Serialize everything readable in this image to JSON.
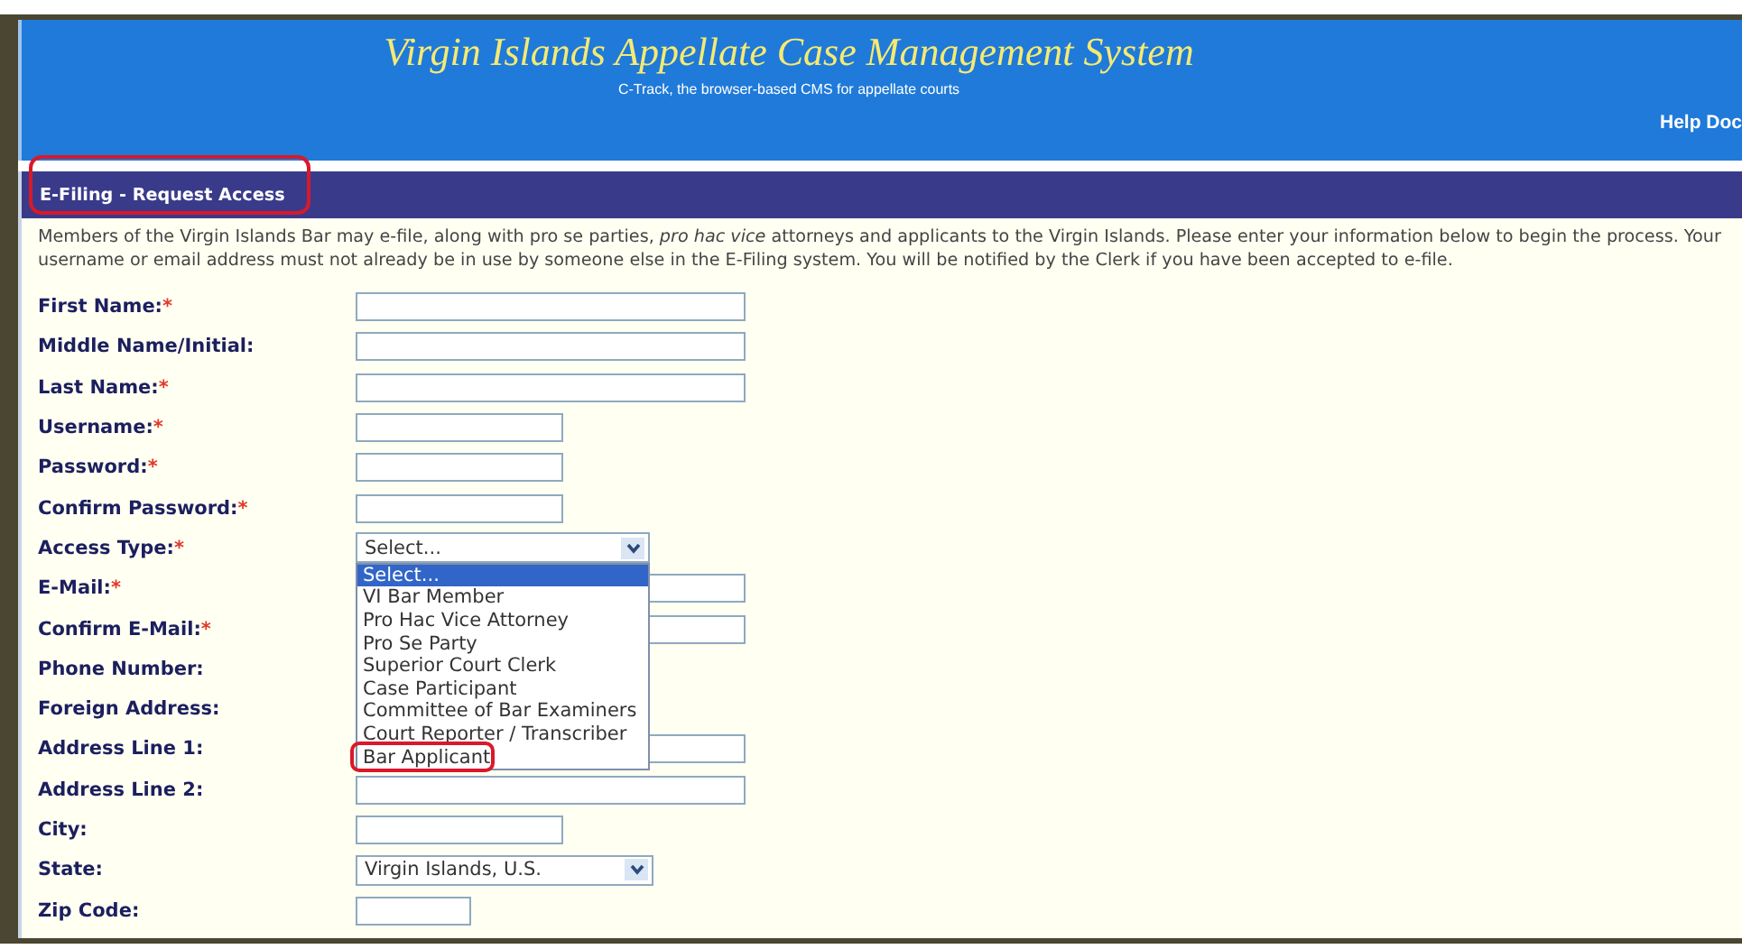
{
  "header": {
    "title": "Virgin Islands Appellate Case Management System",
    "subtitle": "C-Track, the browser-based CMS for appellate courts",
    "link": "Help Doc"
  },
  "section": {
    "title": "E-Filing - Request Access",
    "circled": true
  },
  "intro": "Members of the Virgin Islands Bar may e-file, along with pro se parties, *pro hac vice* attorneys and applicants to the Virgin Islands. Please enter your information below to begin the process. Your username or email address must not already be in use by someone else in the E-Filing system. You will be notified by the Clerk if you have been accepted to e-file.",
  "fields": [
    {
      "label": "First Name:",
      "required_mark": "*",
      "kind": "long"
    },
    {
      "label": "Middle Name/Initial:",
      "kind": "long"
    },
    {
      "label": "Last Name:",
      "required_mark": "*",
      "kind": "long"
    },
    {
      "label": "Username:",
      "required_mark": "*",
      "kind": "short"
    },
    {
      "label": "Password:",
      "required_mark": "*",
      "kind": "short"
    },
    {
      "label": "Confirm Password:",
      "required_mark": "*",
      "kind": "short"
    },
    {
      "label": "Access Type:",
      "required_mark": "*",
      "kind": "select",
      "value": "Select...",
      "expanded": true,
      "options": [
        {
          "label": "Select...",
          "selected": true,
          "circled": false
        },
        {
          "label": "VI Bar Member",
          "selected": false,
          "circled": false
        },
        {
          "label": "Pro Hac Vice Attorney",
          "selected": false,
          "circled": false
        },
        {
          "label": "Pro Se Party",
          "selected": false,
          "circled": false
        },
        {
          "label": "Superior Court Clerk",
          "selected": false,
          "circled": false
        },
        {
          "label": "Case Participant",
          "selected": false,
          "circled": false
        },
        {
          "label": "Committee of Bar Examiners",
          "selected": false,
          "circled": false
        },
        {
          "label": "Court Reporter / Transcriber",
          "selected": false,
          "circled": false
        },
        {
          "label": "Bar Applicant",
          "selected": false,
          "circled": true
        }
      ]
    },
    {
      "label": "E-Mail:",
      "required_mark": "*",
      "kind": "long"
    },
    {
      "label": "Confirm E-Mail:",
      "required_mark": "*",
      "kind": "long"
    },
    {
      "label": "Phone Number:",
      "kind": "none"
    },
    {
      "label": "Foreign Address:",
      "kind": "none"
    },
    {
      "label": "Address Line 1:",
      "kind": "long"
    },
    {
      "label": "Address Line 2:",
      "kind": "long"
    },
    {
      "label": "City:",
      "kind": "short"
    },
    {
      "label": "State:",
      "kind": "select",
      "value": "Virgin Islands, U.S.",
      "expanded": false
    },
    {
      "label": "Zip Code:",
      "kind": "zip"
    }
  ]
}
